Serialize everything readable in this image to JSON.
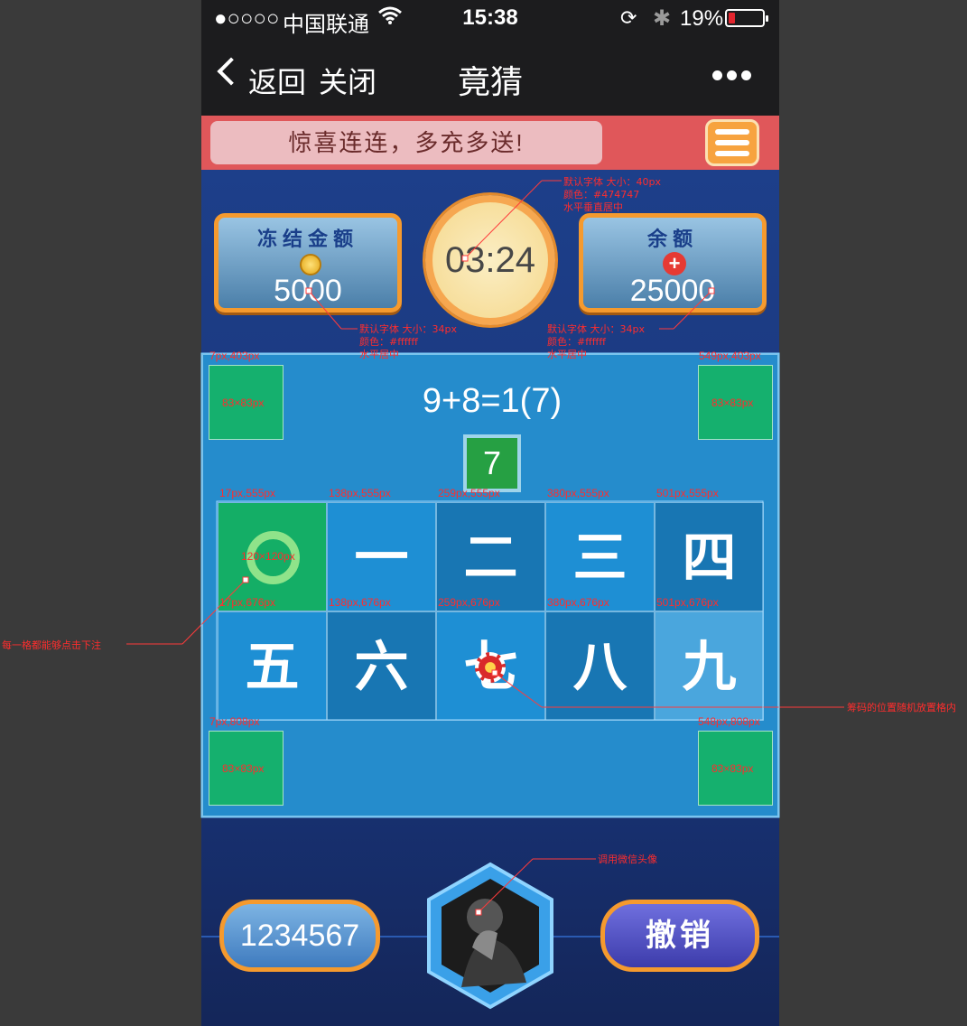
{
  "status_bar": {
    "signal": "●○○○○",
    "carrier": "中国联通",
    "time": "15:38",
    "battery_percent": "19%",
    "battery_level": 0.19
  },
  "nav": {
    "back_label": "返回",
    "close_label": "关闭",
    "title": "竟猜"
  },
  "banner": {
    "text": "惊喜连连，多充多送!"
  },
  "frozen": {
    "label": "冻结金额",
    "value": "5000"
  },
  "balance": {
    "label": "余额",
    "value": "25000"
  },
  "timer": "03:24",
  "equation": "9+8=1(7)",
  "answer": "7",
  "grid": [
    "〇",
    "一",
    "二",
    "三",
    "四",
    "五",
    "六",
    "七",
    "八",
    "九"
  ],
  "bottom": {
    "account": "1234567",
    "undo_label": "撤销"
  },
  "annotations": {
    "timer_note": [
      "默认字体  大小：40px",
      "颜色：#474747",
      "水平垂直居中"
    ],
    "frozen_note": [
      "默认字体  大小：34px",
      "颜色：#ffffff",
      "水平居中"
    ],
    "balance_note": [
      "默认字体  大小：34px",
      "颜色：#ffffff",
      "水平居中"
    ],
    "tl_pos": "7px,403px",
    "tr_pos": "549px,403px",
    "bl_pos": "7px,808px",
    "br_pos": "548px,808px",
    "corner_size": "83×83px",
    "cell_size": "120×120px",
    "row1_pos": [
      "17px,555px",
      "138px,555px",
      "259px,555px",
      "380px,555px",
      "501px,555px"
    ],
    "row2_pos": [
      "17px,676px",
      "138px,676px",
      "259px,676px",
      "380px,676px",
      "501px,676px"
    ],
    "tap_note": "每一格都能够点击下注",
    "chip_note": "筹码的位置随机放置格内",
    "avatar_note": "调用微信头像"
  }
}
